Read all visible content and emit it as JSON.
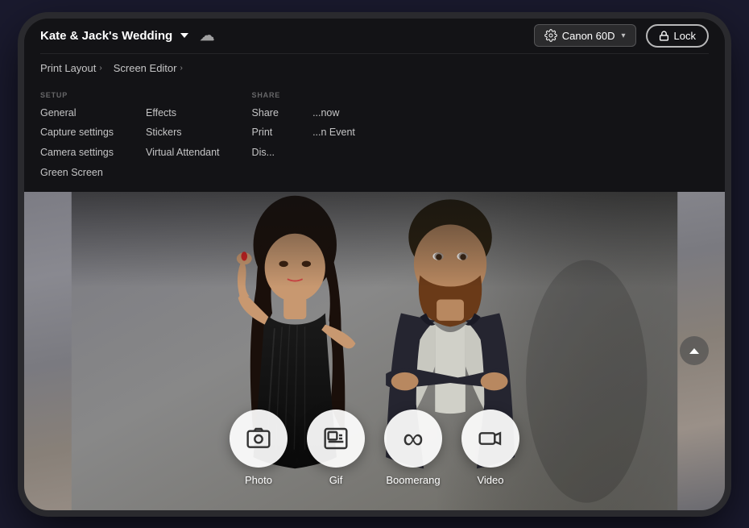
{
  "tablet": {
    "title": "Kate & Jack's Wedding"
  },
  "nav": {
    "project_title": "Kate & Jack's Wedding",
    "cloud_label": "☁",
    "camera_label": "Canon 60D",
    "lock_label": "Lock",
    "links": [
      {
        "label": "Print Layout",
        "arrow": ">"
      },
      {
        "label": "Screen Editor",
        "arrow": ">"
      }
    ],
    "sections": [
      {
        "header": "SETUP",
        "items": [
          "General",
          "Capture settings",
          "Camera settings",
          "Green Screen"
        ]
      },
      {
        "header": "",
        "items": [
          "Effects",
          "Stickers",
          "Virtual Attendant"
        ]
      },
      {
        "header": "SHARE",
        "items": [
          "Share",
          "Print",
          "Dis..."
        ]
      },
      {
        "header": "",
        "items": [
          "...now",
          "...n Event",
          ""
        ]
      }
    ]
  },
  "capture_buttons": [
    {
      "id": "photo",
      "label": "Photo",
      "icon": "📷"
    },
    {
      "id": "gif",
      "label": "Gif",
      "icon": "🎞"
    },
    {
      "id": "boomerang",
      "label": "Boomerang",
      "icon": "∞"
    },
    {
      "id": "video",
      "label": "Video",
      "icon": "🎬"
    }
  ],
  "icons": {
    "chevron_down": "▾",
    "chevron_up": "∧",
    "camera": "⚙",
    "lock": "🔒",
    "cloud": "☁",
    "scroll_up": "∧"
  }
}
